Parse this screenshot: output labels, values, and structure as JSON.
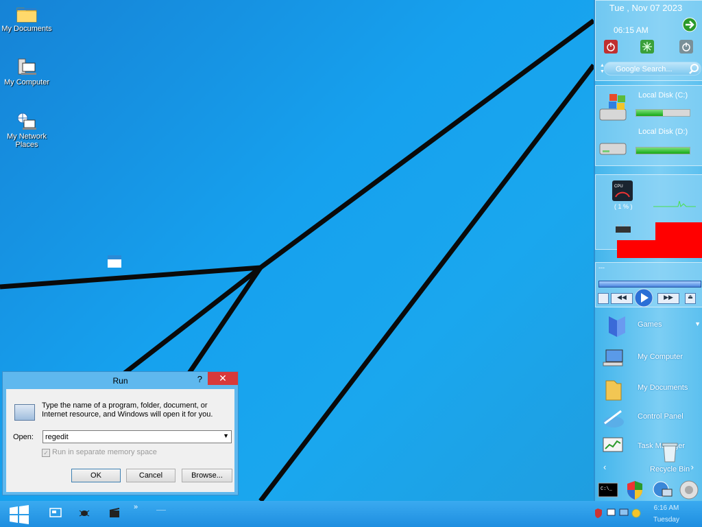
{
  "desktop": {
    "icons": [
      {
        "label": "My Documents",
        "icon": "folder-icon"
      },
      {
        "label": "My Computer",
        "icon": "computer-icon"
      },
      {
        "label": "My Network Places",
        "icon": "network-icon"
      }
    ]
  },
  "run_dialog": {
    "title": "Run",
    "help": "?",
    "close": "✕",
    "prompt": "Type the name of a program, folder, document, or Internet resource, and Windows will open it for you.",
    "open_label": "Open:",
    "open_value": "regedit",
    "checkbox_label": "Run in separate memory space",
    "ok_label": "OK",
    "cancel_label": "Cancel",
    "browse_label": "Browse..."
  },
  "sidebar": {
    "date": "Tue , Nov 07 2023",
    "time": "06:15 AM",
    "search_placeholder": "Google Search...",
    "disks": [
      {
        "label": "Local Disk (C:)",
        "used": 0.5
      },
      {
        "label": "Local Disk (D:)",
        "used": 1.0
      }
    ],
    "cpu_percent": "( 1 % )",
    "cpu_label": "CPU",
    "media_title": "---",
    "menu": [
      {
        "label": "Games"
      },
      {
        "label": "My Computer"
      },
      {
        "label": "My Documents"
      },
      {
        "label": "Control Panel"
      },
      {
        "label": "Task Manager"
      },
      {
        "label": "Recycle Bin"
      }
    ]
  },
  "taskbar": {
    "chevron": "»",
    "clock_time": "6:16 AM",
    "clock_day": "Tuesday"
  },
  "colors": {
    "accent": "#1aa0e8",
    "close_red": "#d8393a",
    "ram_red": "#ff0000"
  }
}
